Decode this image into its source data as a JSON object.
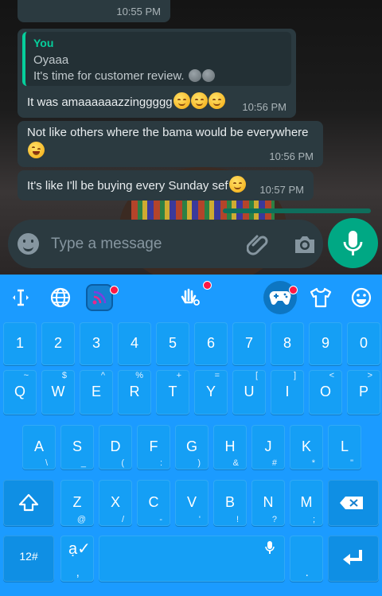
{
  "chat": {
    "msg0_time": "10:55 PM",
    "msg1": {
      "quote_author": "You",
      "quote_line1": "Oyaaa",
      "quote_line2": "It's time for customer review.",
      "text": "It was amaaaaaazzinggggg",
      "time": "10:56 PM"
    },
    "msg2": {
      "text": "Not like others where the bama would be everywhere",
      "time": "10:56 PM"
    },
    "msg3": {
      "text": "It's like I'll be buying every Sunday sef",
      "time": "10:57 PM"
    }
  },
  "compose": {
    "placeholder": "Type a message"
  },
  "keyboard": {
    "toolbar_icons": [
      "text-cursor-icon",
      "globe-icon",
      "rss-icon",
      "hand-icon",
      "gamepad-icon",
      "tshirt-icon",
      "smiley-icon"
    ],
    "number_row": [
      "1",
      "2",
      "3",
      "4",
      "5",
      "6",
      "7",
      "8",
      "9",
      "0"
    ],
    "row1": [
      {
        "k": "Q",
        "s": "~"
      },
      {
        "k": "W",
        "s": "$"
      },
      {
        "k": "E",
        "s": "^"
      },
      {
        "k": "R",
        "s": "%"
      },
      {
        "k": "T",
        "s": "+"
      },
      {
        "k": "Y",
        "s": "="
      },
      {
        "k": "U",
        "s": "["
      },
      {
        "k": "I",
        "s": "]"
      },
      {
        "k": "O",
        "s": "<"
      },
      {
        "k": "P",
        "s": ">"
      }
    ],
    "row2": [
      {
        "k": "A",
        "s": "\\"
      },
      {
        "k": "S",
        "s": "_"
      },
      {
        "k": "D",
        "s": "("
      },
      {
        "k": "F",
        "s": ":"
      },
      {
        "k": "G",
        "s": ")"
      },
      {
        "k": "H",
        "s": "&"
      },
      {
        "k": "J",
        "s": "#"
      },
      {
        "k": "K",
        "s": "*"
      },
      {
        "k": "L",
        "s": "\""
      }
    ],
    "row3": [
      {
        "k": "Z",
        "s": "@"
      },
      {
        "k": "X",
        "s": "/"
      },
      {
        "k": "C",
        "s": "-"
      },
      {
        "k": "V",
        "s": "'"
      },
      {
        "k": "B",
        "s": "!"
      },
      {
        "k": "N",
        "s": "?"
      },
      {
        "k": "M",
        "s": ";"
      }
    ],
    "symbols_label": "12#",
    "comma_label": ",",
    "period_label": "."
  },
  "colors": {
    "keyboard_bg": "#1b9bff",
    "accent_green": "#00a884",
    "bubble": "#2b3a40"
  }
}
